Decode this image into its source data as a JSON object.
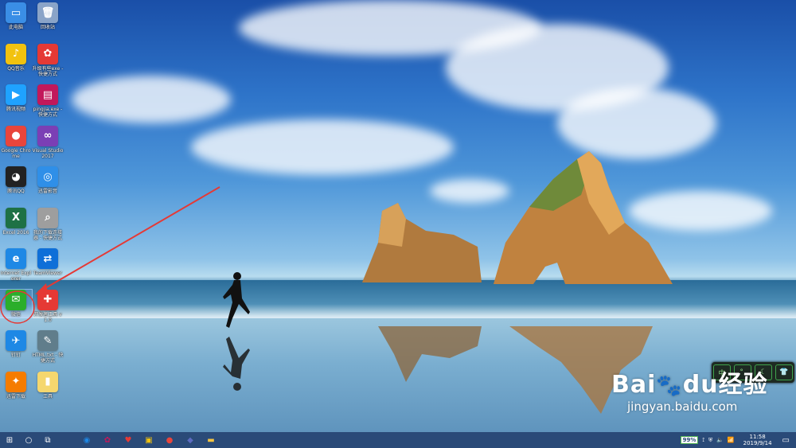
{
  "desktop_icons": [
    {
      "label": "此电脑",
      "glyph": "▭",
      "color": "#3a8ee6"
    },
    {
      "label": "回收站",
      "glyph": "🗑",
      "color": "#8aa4c8"
    },
    {
      "label": "QQ音乐",
      "glyph": "♪",
      "color": "#f2c20f"
    },
    {
      "label": "升级有些exe - 快捷方式",
      "glyph": "✿",
      "color": "#e53935"
    },
    {
      "label": "腾讯视频",
      "glyph": "▶",
      "color": "#1fa2ff"
    },
    {
      "label": "pingjia.exe - 快捷方式",
      "glyph": "▤",
      "color": "#c2185b"
    },
    {
      "label": "Google Chrome",
      "glyph": "●",
      "color": "#e8453c"
    },
    {
      "label": "Visual Studio 2017",
      "glyph": "∞",
      "color": "#7b3fb5"
    },
    {
      "label": "腾讯QQ",
      "glyph": "◕",
      "color": "#222222"
    },
    {
      "label": "迅雷影音",
      "glyph": "◎",
      "color": "#2f8fe8"
    },
    {
      "label": "Excel 2016",
      "glyph": "X",
      "color": "#1e7145"
    },
    {
      "label": "我的下载连接器 - 快捷方式",
      "glyph": "⌕",
      "color": "#9e9e9e"
    },
    {
      "label": "Internet Explorer",
      "glyph": "e",
      "color": "#1e88e5"
    },
    {
      "label": "TeamViewer",
      "glyph": "⇄",
      "color": "#0e6fd8"
    },
    {
      "label": "微信",
      "glyph": "✉",
      "color": "#2bae2b"
    },
    {
      "label": "开发者工具 v1.0",
      "glyph": "✚",
      "color": "#e53935"
    },
    {
      "label": "钉钉",
      "glyph": "✈",
      "color": "#1e88e5"
    },
    {
      "label": "HTML.txt - 快捷方式",
      "glyph": "✎",
      "color": "#607d8b"
    },
    {
      "label": "迅雷下载",
      "glyph": "✦",
      "color": "#f57c00"
    },
    {
      "label": "工具",
      "glyph": "▮",
      "color": "#f5d76e"
    }
  ],
  "ime": {
    "chinese": "中",
    "punct": "°,",
    "moon": "☾",
    "skin": "👕"
  },
  "watermark": {
    "brand": "Bai",
    "brand2": "du",
    "brand_cn": "经验",
    "url": "jingyan.baidu.com"
  },
  "taskbar": {
    "start": "⊞",
    "search": "○",
    "taskview": "⧉",
    "apps": [
      {
        "name": "edge",
        "glyph": "◉",
        "color": "#1e88e5"
      },
      {
        "name": "app2",
        "glyph": "✿",
        "color": "#c2185b"
      },
      {
        "name": "app3",
        "glyph": "♥",
        "color": "#e53935"
      },
      {
        "name": "app4",
        "glyph": "▣",
        "color": "#f2c20f"
      },
      {
        "name": "chrome",
        "glyph": "●",
        "color": "#e8453c"
      },
      {
        "name": "app6",
        "glyph": "◆",
        "color": "#5c6bc0"
      },
      {
        "name": "explorer",
        "glyph": "▬",
        "color": "#f5c542"
      }
    ],
    "battery": "99%",
    "time": "11:58",
    "date": "2019/9/14"
  }
}
